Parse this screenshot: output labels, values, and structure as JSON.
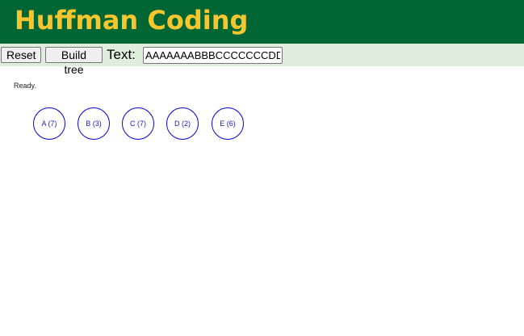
{
  "header": {
    "title": "Huffman Coding",
    "background": "#006633",
    "title_color": "#f7c52d"
  },
  "toolbar": {
    "reset_label": "Reset",
    "build_label": "Build tree",
    "text_label": "Text:",
    "text_value": "AAAAAAABBBCCCCCCCDDEEEEEE",
    "background": "#dfeedd"
  },
  "status": {
    "message": "Ready."
  },
  "nodes": [
    {
      "label": "A (7)"
    },
    {
      "label": "B (3)"
    },
    {
      "label": "C (7)"
    },
    {
      "label": "D (2)"
    },
    {
      "label": "E (6)"
    }
  ]
}
